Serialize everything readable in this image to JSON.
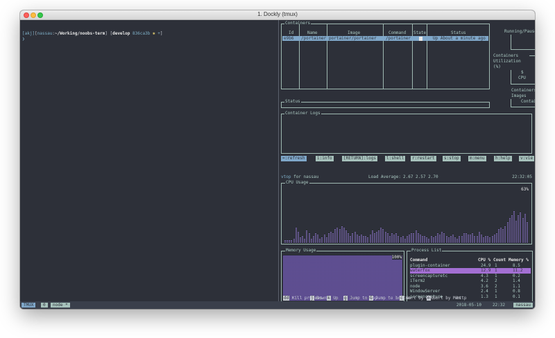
{
  "window": {
    "title": "1. Dockly (tmux)"
  },
  "shell": {
    "prompt_user": "nassau",
    "prompt_path": "~/Working/noobs-term",
    "prompt_branch": "develop",
    "prompt_hash": "836ca3b",
    "prompt_extra": "+",
    "prompt_prefix": "[akj]",
    "prompt_tail": "❯"
  },
  "containers": {
    "label": "Containers",
    "headers": [
      "Id",
      "Name",
      "Image",
      "Command",
      "State",
      "Status"
    ],
    "rows": [
      {
        "id": "e9b6",
        "name": "/portainer",
        "image": "portainer/portainer",
        "command": "/portainer",
        "state": "",
        "status": "Up About a minute ago"
      }
    ]
  },
  "side_panels": {
    "running": "Running/Paused/Stopped",
    "utilization_title": "Containers Utilization (%)",
    "utilization_dollar": "$",
    "utilization_cpu": "CPU",
    "vs_images_title": "Containers vs Images",
    "vs_images_value": "Containers"
  },
  "status_box": {
    "label": "Status"
  },
  "logs_box": {
    "label": "Container Logs"
  },
  "keys": [
    {
      "label": "=:refresh",
      "active": true
    },
    {
      "label": "i:info",
      "active": false
    },
    {
      "label": "[RETURN]:logs",
      "active": false
    },
    {
      "label": "l:shell",
      "active": false
    },
    {
      "label": "r:restart",
      "active": false
    },
    {
      "label": "s:stop",
      "active": false
    },
    {
      "label": "m:menu",
      "active": false
    },
    {
      "label": "h:help",
      "active": false
    },
    {
      "label": "v:vie",
      "active": false
    }
  ],
  "vtop": {
    "app": "vtop",
    "for_label": "for",
    "user": "nassau",
    "load_label": "Load Average:",
    "load_values": "2.67 2.57 2.70",
    "time": "22:32:05"
  },
  "cpu": {
    "label": "CPU Usage",
    "percent_label": "63%",
    "values": [
      4,
      5,
      6,
      5,
      7,
      30,
      22,
      10,
      14,
      9,
      25,
      18,
      8,
      12,
      20,
      15,
      9,
      11,
      16,
      10,
      20,
      22,
      18,
      28,
      30,
      26,
      32,
      30,
      24,
      20,
      14,
      18,
      22,
      15,
      12,
      17,
      14,
      12,
      10,
      16,
      24,
      20,
      22,
      25,
      30,
      27,
      22,
      18,
      14,
      20,
      16,
      18,
      13,
      10,
      12,
      9,
      14,
      16,
      20,
      18,
      24,
      20,
      15,
      12,
      14,
      11,
      9,
      12,
      10,
      14,
      18,
      16,
      22,
      20,
      12,
      10,
      14,
      16,
      10,
      8,
      12,
      14,
      20,
      18,
      15,
      16,
      18,
      12,
      14,
      22,
      16,
      10,
      12,
      14,
      11,
      14,
      16,
      20,
      26,
      30,
      28,
      34,
      40,
      48,
      56,
      63,
      45,
      54,
      60,
      50,
      58,
      40
    ]
  },
  "memory": {
    "label": "Memory Usage",
    "percent_label": "100%"
  },
  "processes": {
    "label": "Process List",
    "headers": [
      "Command",
      "CPU %",
      "Count",
      "Memory %"
    ],
    "rows": [
      {
        "command": "plugin-container",
        "cpu": "24.9",
        "count": "1",
        "memory": "8.5",
        "selected": false
      },
      {
        "command": "waterfox",
        "cpu": "12.9",
        "count": "1",
        "memory": "11.2",
        "selected": true
      },
      {
        "command": "screencapturetc",
        "cpu": "4.3",
        "count": "1",
        "memory": "0.2",
        "selected": false
      },
      {
        "command": "iTerm2",
        "cpu": "4.2",
        "count": "2",
        "memory": "1.4",
        "selected": false
      },
      {
        "command": "node",
        "cpu": "3.6",
        "count": "2",
        "memory": "1.1",
        "selected": false
      },
      {
        "command": "WindowServer",
        "cpu": "2.4",
        "count": "1",
        "memory": "0.8",
        "selected": false
      },
      {
        "command": "screencapture",
        "cpu": "1.3",
        "count": "1",
        "memory": "0.1",
        "selected": false
      }
    ]
  },
  "help_bar": [
    {
      "key": "dd",
      "label": "Kill process"
    },
    {
      "key": "j",
      "label": "Down"
    },
    {
      "key": "k",
      "label": "Up"
    },
    {
      "key": "g",
      "label": "Jump to top"
    },
    {
      "key": "G",
      "label": "Jump to bottom"
    },
    {
      "key": "c",
      "label": "Sort by CPU"
    },
    {
      "key": "m",
      "label": "Sort by Mem"
    },
    {
      "key": "",
      "label": "http"
    }
  ],
  "tmux": {
    "session": "TMUX",
    "window_index": "0",
    "window_name": "node",
    "window_flag": "*",
    "date": "2018-05-10",
    "time": "22:32",
    "host": "nassau"
  },
  "colors": {
    "accent_blue": "#7fa7c9",
    "accent_purple": "#8b72c9",
    "selection_purple": "#a36fd3",
    "border": "#9fb9b2"
  }
}
